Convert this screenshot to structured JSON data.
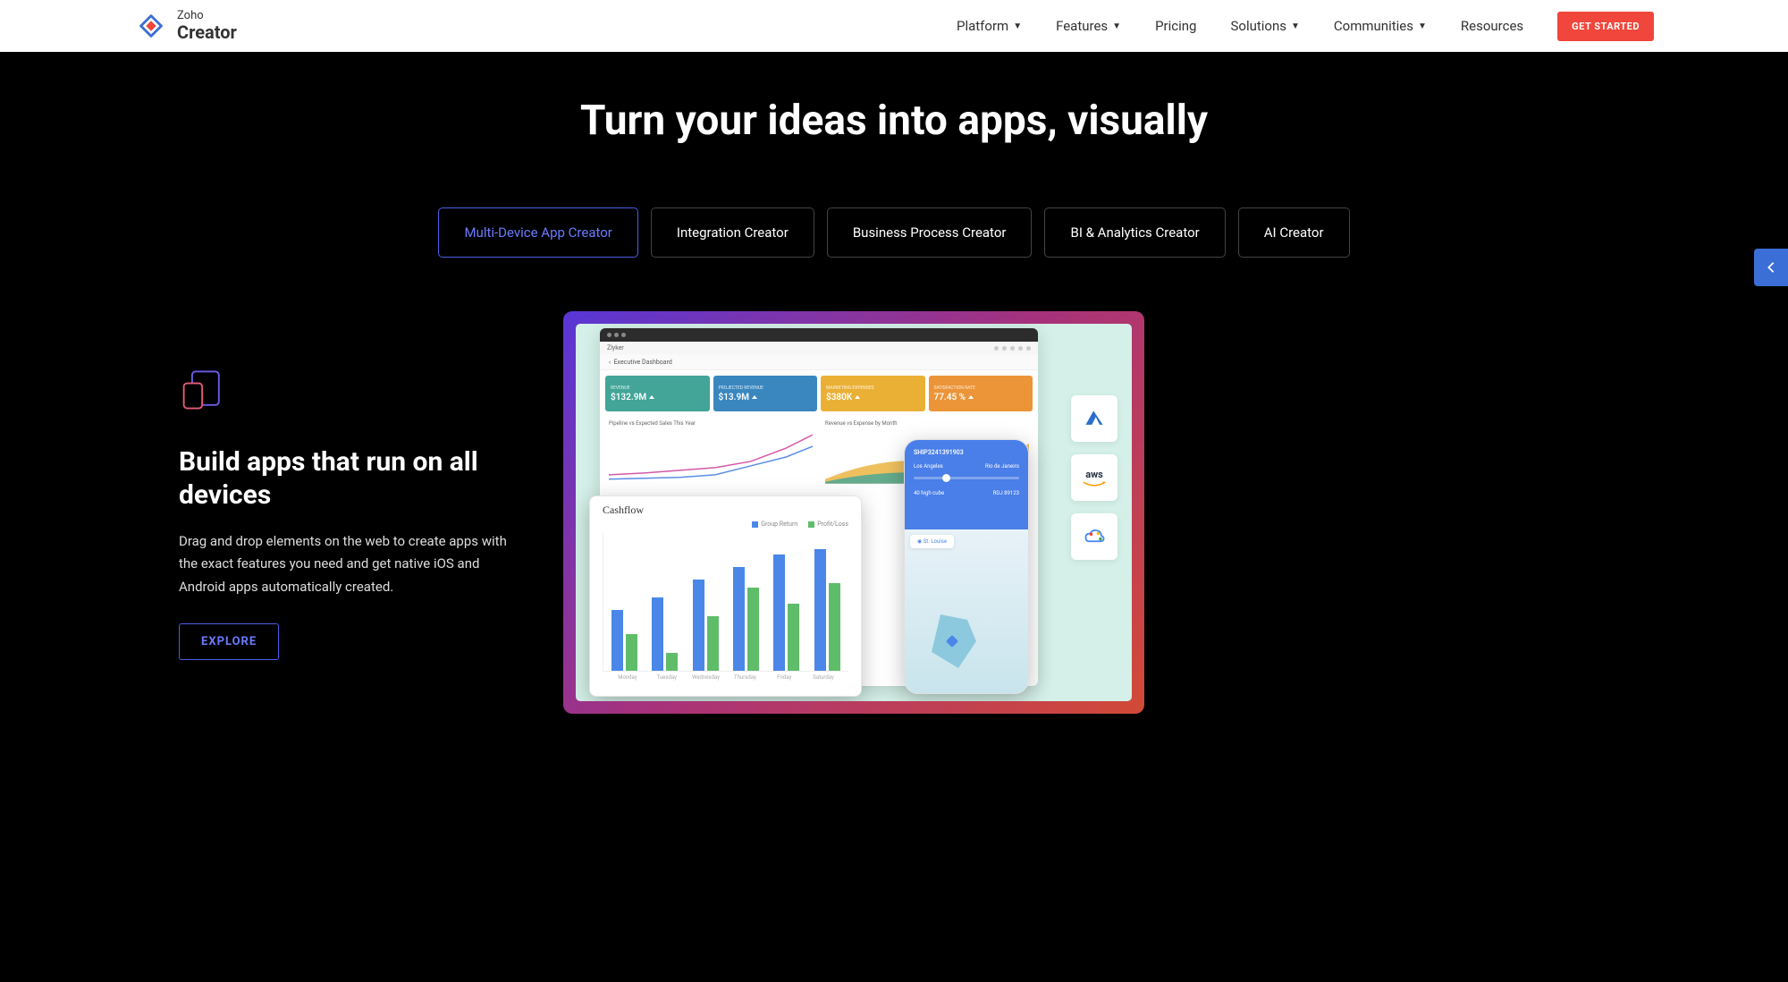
{
  "header": {
    "logo_line1": "Zoho",
    "logo_line2": "Creator",
    "nav": [
      {
        "label": "Platform",
        "dropdown": true
      },
      {
        "label": "Features",
        "dropdown": true
      },
      {
        "label": "Pricing",
        "dropdown": false
      },
      {
        "label": "Solutions",
        "dropdown": true
      },
      {
        "label": "Communities",
        "dropdown": true
      },
      {
        "label": "Resources",
        "dropdown": false
      }
    ],
    "cta": "GET STARTED"
  },
  "hero": {
    "title": "Turn your ideas into apps, visually",
    "tabs": [
      "Multi-Device App Creator",
      "Integration Creator",
      "Business Process Creator",
      "BI & Analytics Creator",
      "AI Creator"
    ],
    "active_tab": 0
  },
  "feature": {
    "title": "Build apps that run on all devices",
    "description": "Drag and drop elements on the web to create apps with the exact features you need and get native iOS and Android apps automatically created.",
    "cta": "EXPLORE"
  },
  "mockup": {
    "app_name": "Zlyker",
    "dashboard_tab": "Executive Dashboard",
    "metrics": [
      {
        "label": "REVENUE",
        "value": "$132.9M",
        "color": "teal"
      },
      {
        "label": "PROJECTED REVENUE",
        "value": "$13.9M",
        "color": "blue"
      },
      {
        "label": "MARKETING EXPENSES",
        "value": "$380K",
        "color": "yellow"
      },
      {
        "label": "SATISFACTION RATE",
        "value": "77.45 %",
        "color": "orange"
      }
    ],
    "chart1_title": "Pipeline vs Expected Sales This Year",
    "chart2_title": "Revenue vs Expense by Month",
    "tablet": {
      "title": "Cashflow",
      "legend": [
        "Group Return",
        "Profit/Loss"
      ],
      "days": [
        "Monday",
        "Tuesday",
        "Wednesday",
        "Thursday",
        "Friday",
        "Saturday"
      ]
    },
    "phone": {
      "shipment_id": "SHIP3241391903",
      "from": "Los Angeles",
      "to": "Rio de Janeiro",
      "cargo": "40 high cube",
      "ref": "RDJ 89123",
      "location": "St. Louise"
    },
    "cloud_providers": [
      "azure",
      "aws",
      "gcp"
    ]
  },
  "chart_data": {
    "type": "bar",
    "title": "Cashflow",
    "categories": [
      "Monday",
      "Tuesday",
      "Wednesday",
      "Thursday",
      "Friday",
      "Saturday"
    ],
    "series": [
      {
        "name": "Group Return",
        "color": "#4a87e8",
        "values": [
          50,
          60,
          75,
          85,
          95,
          100
        ]
      },
      {
        "name": "Profit/Loss",
        "color": "#5fbd6a",
        "values": [
          30,
          15,
          45,
          68,
          55,
          72
        ]
      }
    ],
    "ylim": [
      0,
      110
    ]
  }
}
